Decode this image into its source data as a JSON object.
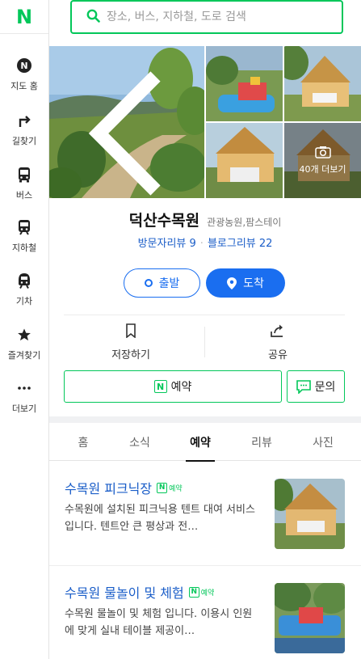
{
  "nav": {
    "logo": "N",
    "items": [
      {
        "label": "지도 홈",
        "icon": "map-pin-icon"
      },
      {
        "label": "길찾기",
        "icon": "directions-icon"
      },
      {
        "label": "버스",
        "icon": "bus-icon"
      },
      {
        "label": "지하철",
        "icon": "subway-icon"
      },
      {
        "label": "기차",
        "icon": "train-icon"
      },
      {
        "label": "즐겨찾기",
        "icon": "star-icon"
      },
      {
        "label": "더보기",
        "icon": "more-icon"
      }
    ]
  },
  "search": {
    "placeholder": "장소, 버스, 지하철, 도로 검색"
  },
  "photos": {
    "more_label": "40개 더보기"
  },
  "place": {
    "name": "덕산수목원",
    "category": "관광농원,팜스테이",
    "visitor_reviews": "방문자리뷰 9",
    "blog_reviews": "블로그리뷰 22"
  },
  "route": {
    "depart": "출발",
    "arrive": "도착"
  },
  "actions": {
    "save": "저장하기",
    "share": "공유"
  },
  "booking": {
    "reserve": "예약",
    "inquiry": "문의"
  },
  "tabs": [
    "홈",
    "소식",
    "예약",
    "리뷰",
    "사진"
  ],
  "active_tab": "예약",
  "items": [
    {
      "name": "수목원 피크닉장",
      "badge": "예약",
      "desc": "수목원에 설치된 피크닉용 텐트 대여 서비스입니다. 텐트안 큰 평상과 전…"
    },
    {
      "name": "수목원 물놀이 및 체험",
      "badge": "예약",
      "desc": "수목원 물놀이 및 체험 입니다. 이용시 인원 에 맞게 실내 테이블 제공이…"
    }
  ],
  "colors": {
    "brand": "#03c75a",
    "link": "#1a5dc8",
    "primary": "#1a6ef0"
  }
}
